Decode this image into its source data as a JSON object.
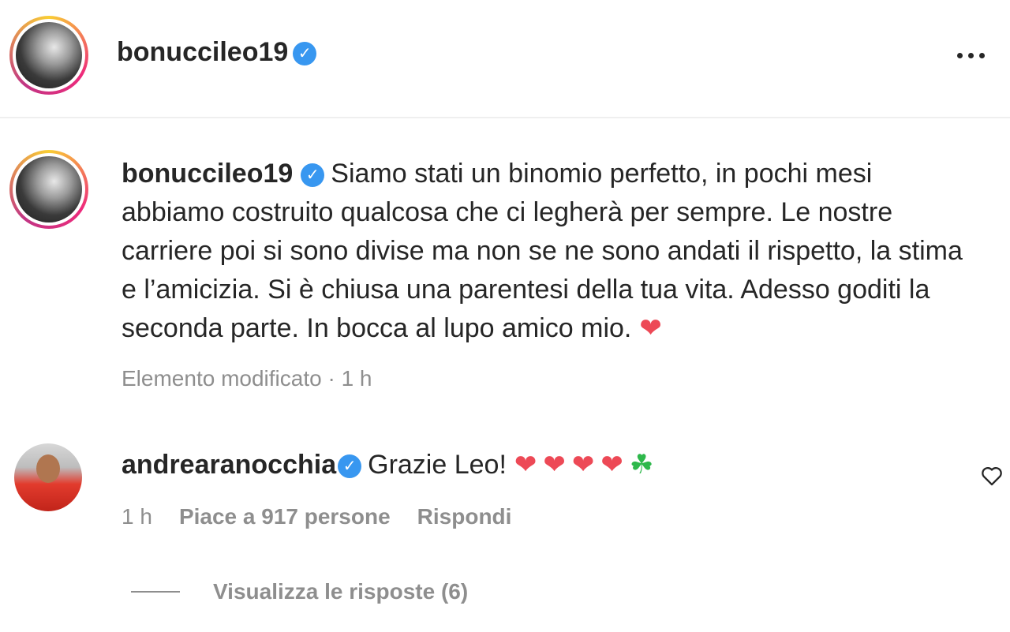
{
  "post": {
    "author": "bonuccileo19",
    "verified_icon": "verified-badge-icon",
    "more_icon": "more-options-icon"
  },
  "caption": {
    "username": "bonuccileo19",
    "text": "Siamo stati un binomio perfetto, in pochi mesi abbiamo costruito qualcosa che ci legherà per sempre. Le nostre carriere poi si sono divise ma non se ne sono andati il rispetto, la stima e l’amicizia. Si è chiusa una parentesi della tua vita. Adesso goditi la seconda parte. In bocca al lupo amico mio.",
    "emoji": "❤",
    "edited_label": "Elemento modificato",
    "separator": "·",
    "time": "1 h"
  },
  "comment": {
    "username": "andrearanocchia",
    "text": "Grazie Leo!",
    "hearts": "❤❤❤❤",
    "clover": "☘",
    "time": "1 h",
    "likes": "Piace a 917 persone",
    "reply_label": "Rispondi",
    "view_replies": "Visualizza le risposte (6)"
  },
  "colors": {
    "link_blue": "#3897f0",
    "heart_red": "#ed4956",
    "secondary_text": "#8e8e8e"
  }
}
